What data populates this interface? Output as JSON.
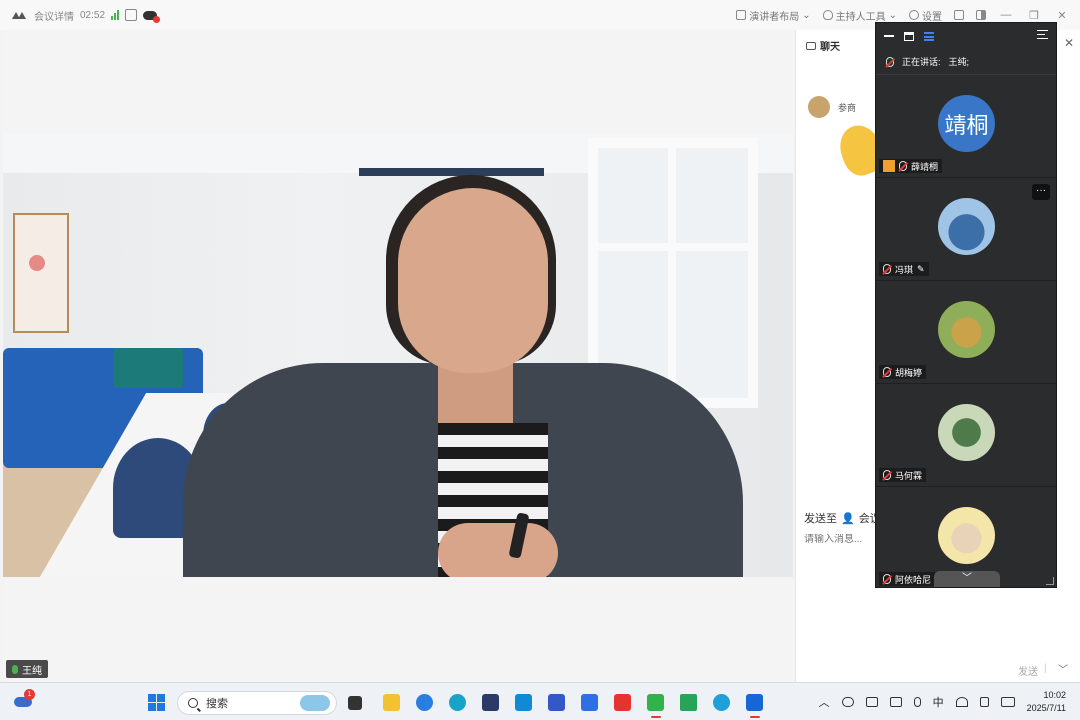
{
  "topbar": {
    "meeting_info": "会议详情",
    "duration": "02:52",
    "presenter_layout": "演讲者布局",
    "host_tools": "主持人工具",
    "settings": "设置",
    "window_controls": [
      "—",
      "❐",
      "✕"
    ]
  },
  "stage": {
    "speaker_name": "王纯"
  },
  "chat": {
    "title": "聊天",
    "close": "✕",
    "message_sender": "参商",
    "send_to_label": "发送至",
    "send_to_target": "会议",
    "input_placeholder": "请输入消息...",
    "send_label": "发送",
    "send_separator": "|",
    "send_options": "﹀"
  },
  "participants": {
    "speaking_label": "正在讲话:",
    "speaking_name": "王纯;",
    "more": "···",
    "scroll_down": "﹀",
    "list": [
      {
        "name": "薛靖桐",
        "avatar_text": "靖桐",
        "host": true
      },
      {
        "name": "冯琪",
        "edit_icon": true
      },
      {
        "name": "胡梅婷"
      },
      {
        "name": "马何霖"
      },
      {
        "name": "阿依哈尼"
      }
    ]
  },
  "taskbar": {
    "weather_badge": "1",
    "search_placeholder": "搜索",
    "ime": "中",
    "time": "10:02",
    "date": "2025/7/11"
  },
  "colors": {
    "accent_blue": "#3a76c8",
    "live_green": "#4caf50",
    "alert_red": "#e53935",
    "panel_dark": "#2b2c2e"
  }
}
